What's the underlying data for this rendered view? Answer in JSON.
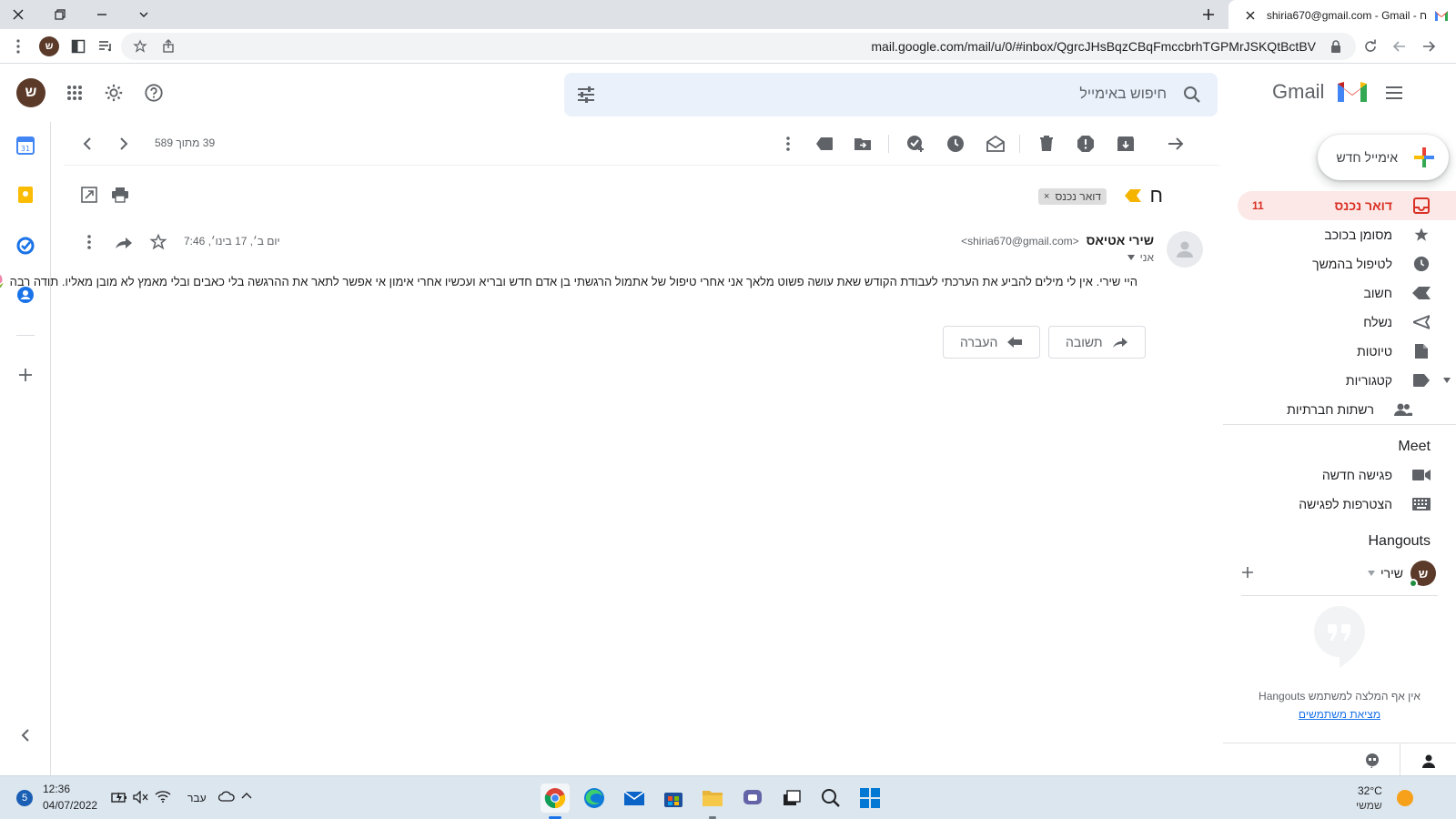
{
  "browser": {
    "tab_title": "shiria670@gmail.com - Gmail - ח",
    "url": "mail.google.com/mail/u/0/#inbox/QgrcJHsBqzCBqFmccbrhTGPMrJSKQtBctBV",
    "profile_initial": "ש"
  },
  "header": {
    "logo_text": "Gmail",
    "search_placeholder": "חיפוש באימייל",
    "account_initial": "ש"
  },
  "nav": {
    "compose_label": "אימייל חדש",
    "items": [
      {
        "label": "דואר נכנס",
        "count": "11",
        "icon": "inbox-icon"
      },
      {
        "label": "מסומן בכוכב",
        "icon": "star-icon"
      },
      {
        "label": "לטיפול בהמשך",
        "icon": "clock-icon"
      },
      {
        "label": "חשוב",
        "icon": "important-icon"
      },
      {
        "label": "נשלח",
        "icon": "send-icon"
      },
      {
        "label": "טיוטות",
        "icon": "draft-icon"
      },
      {
        "label": "קטגוריות",
        "icon": "label-icon"
      },
      {
        "label": "רשתות חברתיות",
        "icon": "people-icon"
      }
    ],
    "meet_title": "Meet",
    "meet_items": [
      {
        "label": "פגישה חדשה",
        "icon": "video-icon"
      },
      {
        "label": "הצטרפות לפגישה",
        "icon": "keyboard-icon"
      }
    ],
    "hangouts_title": "Hangouts",
    "hangouts_user": "שירי",
    "hangouts_user_initial": "ש",
    "hangouts_empty": "אין אף המלצה למשתמש Hangouts",
    "hangouts_link": "מציאת משתמשים"
  },
  "toolbar": {
    "pager_text": "39 מתוך 589"
  },
  "message": {
    "subject": "ח",
    "label_chip": "דואר נכנס",
    "label_chip_close": "×",
    "sender_name": "שירי אטיאס",
    "sender_email": "<shiria670@gmail.com>",
    "to_label": "אני",
    "date": "יום ב׳, 17 בינו׳, 7:46",
    "body": "היי שירי. אין לי מילים להביע את הערכתי  לעבודת הקודש שאת עושה פשוט מלאך  אני אחרי טיפול של אתמול הרגשתי בן אדם חדש ובריא ועכשיו אחרי אימון אי אפשר לתאר את ההרגשה בלי כאבים ובלי מאמץ לא מובן מאליו. תודה רבה 🌷",
    "reply_label": "תשובה",
    "forward_label": "העברה"
  },
  "taskbar": {
    "time": "12:36",
    "date": "04/07/2022",
    "lang": "עבר",
    "weather_temp": "32°C",
    "weather_desc": "שמשי",
    "notification_count": "5"
  },
  "colors": {
    "gmail_red": "#d93025",
    "inbox_active_bg": "#fce8e6",
    "avatar_brown": "#5b3a29",
    "search_bg": "#eaf1fb"
  }
}
